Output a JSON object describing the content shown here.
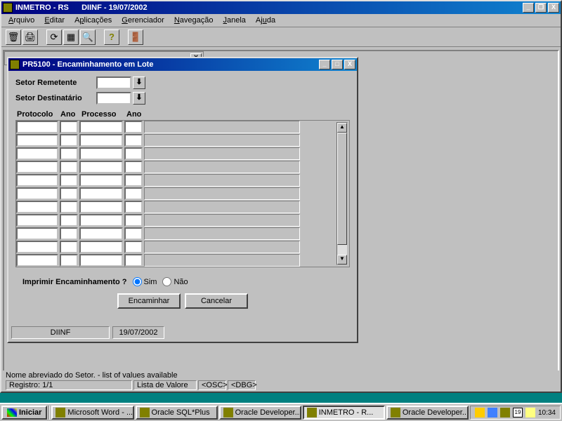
{
  "app": {
    "title": "INMETRO - RS      DIINF - 19/07/2002"
  },
  "menu": {
    "arquivo": "Arquivo",
    "editar": "Editar",
    "aplicacoes": "Aplicações",
    "gerenciador": "Gerenciador",
    "navegacao": "Navegação",
    "janela": "Janela",
    "ajuda": "Ajuda"
  },
  "form": {
    "title": "PR5100 - Encaminhamento em Lote",
    "setor_remetente_label": "Setor Remetente",
    "setor_destinatario_label": "Setor Destinatário",
    "col_protocolo": "Protocolo",
    "col_ano1": "Ano",
    "col_processo": "Processo",
    "col_ano2": "Ano",
    "imprimir_label": "Imprimir Encaminhamento ?",
    "opt_sim": "Sim",
    "opt_nao": "Não",
    "btn_encaminhar": "Encaminhar",
    "btn_cancelar": "Cancelar",
    "status_setor": "DIINF",
    "status_data": "19/07/2002"
  },
  "status": {
    "hint": "Nome abreviado do Setor. - list of values available",
    "registro": "Registro: 1/1",
    "lov": "Lista de Valore",
    "osc": "<OSC>",
    "dbg": "<DBG>"
  },
  "taskbar": {
    "start": "Iniciar",
    "tasks": [
      "Microsoft Word - ...",
      "Oracle SQL*Plus",
      "Oracle Developer...",
      "INMETRO - R...",
      "Oracle Developer..."
    ],
    "clock": "10:34"
  }
}
